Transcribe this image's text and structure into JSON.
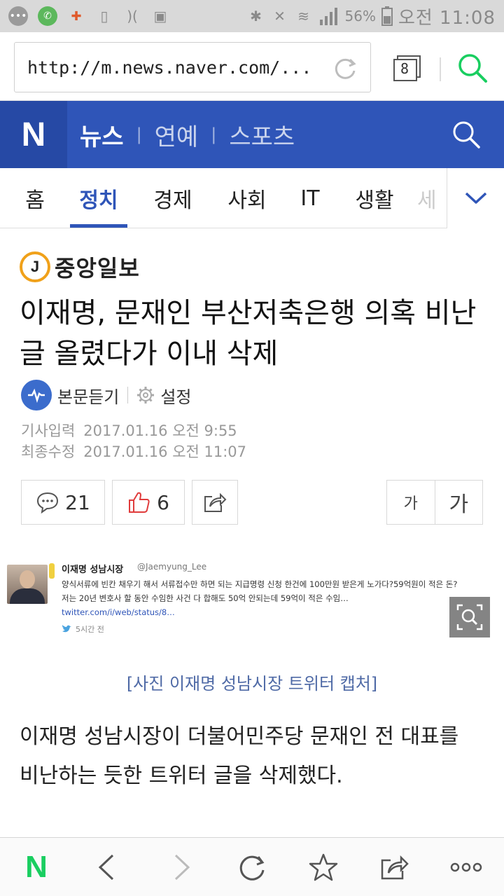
{
  "status_bar": {
    "battery_percent": "56%",
    "time": "오전 11:08"
  },
  "browser": {
    "url": "http://m.news.naver.com/...",
    "tab_count": "8"
  },
  "header": {
    "logo": "N",
    "services": [
      "뉴스",
      "연예",
      "스포츠"
    ]
  },
  "categories": {
    "tabs": [
      "홈",
      "정치",
      "경제",
      "사회",
      "IT",
      "생활",
      "세"
    ],
    "active": "정치"
  },
  "article": {
    "press_badge": "J",
    "press_name": "중앙일보",
    "headline": "이재명, 문재인 부산저축은행 의혹 비난글 올렸다가 이내 삭제",
    "listen_label": "본문듣기",
    "settings_label": "설정",
    "published_label": "기사입력",
    "published_value": "2017.01.16 오전 9:55",
    "modified_label": "최종수정",
    "modified_value": "2017.01.16 오전 11:07",
    "comment_count": "21",
    "like_count": "6",
    "font_small": "가",
    "font_large": "가",
    "image_caption": "[사진 이재명 성남시장 트위터 캡처]",
    "body_first_paragraph": "이재명 성남시장이 더불어민주당 문재인 전 대표를 비난하는 듯한 트위터 글을 삭제했다."
  },
  "tweet": {
    "author": "이재명 성남시장",
    "handle": "@Jaemyung_Lee",
    "text": "양식서류에 빈칸 채우기 해서 서류접수만 하면 되는 지급명령 신청 한건에 100만원 받은게 노가다?59억원이 적은 돈?저는 20년 변호사 할 동안 수임한 사건 다 합해도 50억 안되는데 59억이 적은 수임…",
    "link": "twitter.com/i/web/status/8…",
    "time": "5시간 전"
  },
  "colors": {
    "naver_blue": "#2f55b8",
    "naver_green": "#19ce60",
    "caption_blue": "#4f6aa6",
    "press_badge_orange": "#f0a11a"
  }
}
